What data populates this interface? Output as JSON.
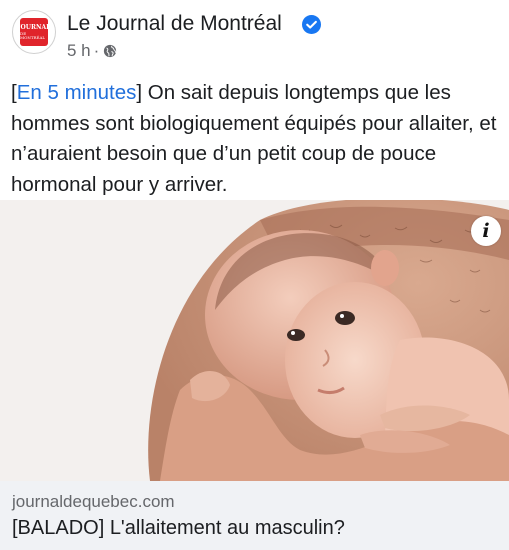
{
  "post": {
    "page_name": "Le Journal de Montréal",
    "verified": true,
    "time": "5 h",
    "separator": "·",
    "audience_icon": "globe-icon",
    "avatar_logo_line1": "JOURNAL",
    "avatar_logo_line2": "DE MONTRÉAL",
    "text_prefix": "[",
    "text_tag": "En 5 minutes",
    "text_suffix": "]",
    "text_body": " On sait depuis longtemps que les hommes sont biologiquement équipés pour allaiter, et n’auraient besoin que d’un petit coup de pouce hormonal pour y arriver."
  },
  "media": {
    "info_label": "i",
    "info_icon": "info-icon"
  },
  "link": {
    "domain": "journaldequebec.com",
    "title": "[BALADO] L'allaitement au masculin?"
  },
  "colors": {
    "link_blue": "#216fdb",
    "verified_blue": "#1877f2",
    "brand_red": "#e0242b",
    "secondary_text": "#65676b",
    "card_background": "#f0f2f5"
  }
}
